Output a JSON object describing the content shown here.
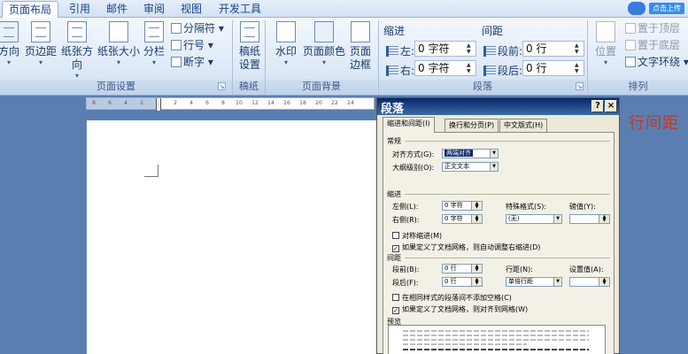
{
  "tabs": [
    {
      "label": "页面布局",
      "active": true
    },
    {
      "label": "引用",
      "active": false
    },
    {
      "label": "邮件",
      "active": false
    },
    {
      "label": "审阅",
      "active": false
    },
    {
      "label": "视图",
      "active": false
    },
    {
      "label": "开发工具",
      "active": false
    }
  ],
  "cloud": {
    "button_label": "点击上传"
  },
  "ribbon": {
    "groups": {
      "page_setup": "页面设置",
      "manuscript": "稿纸",
      "page_background": "页面背景",
      "paragraph": "段落",
      "arrange": "排列"
    },
    "page_setup": {
      "direction": "方向",
      "margins": "页边距",
      "orientation": "纸张方向",
      "size": "纸张大小",
      "columns": "分栏",
      "breaks": "分隔符",
      "line_numbers": "行号",
      "hyphenation": "断字"
    },
    "manuscript": {
      "settings_line1": "稿纸",
      "settings_line2": "设置"
    },
    "page_background": {
      "watermark": "水印",
      "page_color": "页面颜色",
      "borders_line1": "页面",
      "borders_line2": "边框"
    },
    "paragraph": {
      "indent_header": "缩进",
      "spacing_header": "间距",
      "left_label": "左:",
      "left_value": "0 字符",
      "right_label": "右:",
      "right_value": "0 字符",
      "before_label": "段前:",
      "before_value": "0 行",
      "after_label": "段后:",
      "after_value": "0 行"
    },
    "arrange": {
      "position": "位置",
      "bring_front": "置于顶层",
      "send_back": "置于底层",
      "text_wrap": "文字环绕"
    }
  },
  "ruler": {
    "ticks": [
      "8",
      "6",
      "4",
      "2",
      "",
      "2",
      "4",
      "6",
      "8",
      "10",
      "12",
      "14",
      "16",
      "18",
      "20",
      "22",
      "24"
    ]
  },
  "side_text": "行间距",
  "dialog": {
    "title": "段落",
    "help": "?",
    "close": "×",
    "tabs": [
      "缩进和间距(I)",
      "换行和分页(P)",
      "中文版式(H)"
    ],
    "general": {
      "header": "常规",
      "alignment_label": "对齐方式(G):",
      "alignment_value": "两端对齐",
      "outline_label": "大纲级别(O):",
      "outline_value": "正文文本"
    },
    "indent": {
      "header": "缩进",
      "left_label": "左侧(L):",
      "left_value": "0 字符",
      "right_label": "右侧(R):",
      "right_value": "0 字符",
      "special_label": "特殊格式(S):",
      "special_value": "(无)",
      "by_label": "磅值(Y):",
      "by_value": "",
      "mirror": "对称缩进(M)",
      "auto_right": "如果定义了文档网格，则自动调整右缩进(D)"
    },
    "spacing": {
      "header": "间距",
      "before_label": "段前(B):",
      "before_value": "0 行",
      "after_label": "段后(F):",
      "after_value": "0 行",
      "line_label": "行距(N):",
      "line_value": "单倍行距",
      "at_label": "设置值(A):",
      "at_value": "",
      "no_space": "在相同样式的段落间不添加空格(C)",
      "snap_grid": "如果定义了文档网格，则对齐到网格(W)"
    },
    "preview_header": "预览",
    "checks": {
      "mirror": false,
      "auto_right": true,
      "no_space": false,
      "snap_grid": true
    }
  }
}
